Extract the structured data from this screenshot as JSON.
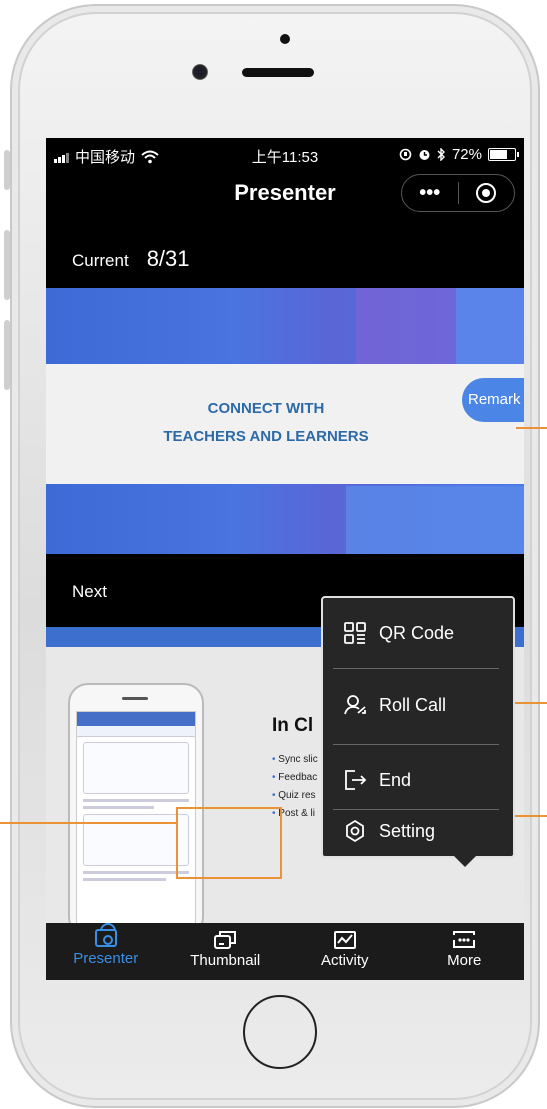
{
  "status_bar": {
    "carrier": "中国移动",
    "time": "上午11:53",
    "battery": "72%",
    "battery_level": 0.72
  },
  "nav": {
    "title": "Presenter",
    "more_glyph": "•••"
  },
  "current": {
    "label": "Current",
    "page": "8/31"
  },
  "current_slide": {
    "line1": "CONNECT WITH",
    "line2": "TEACHERS AND LEARNERS",
    "remark_label": "Remark"
  },
  "next": {
    "label": "Next"
  },
  "next_slide": {
    "heading": "In Cl",
    "bullets": [
      "Sync slic",
      "Feedbac",
      "Quiz res",
      "Post & li"
    ]
  },
  "popup_menu": {
    "items": [
      {
        "label": "QR Code",
        "icon": "qr-code-icon"
      },
      {
        "label": "Roll Call",
        "icon": "roll-call-icon"
      },
      {
        "label": "End",
        "icon": "exit-icon"
      },
      {
        "label": "Setting",
        "icon": "gear-icon"
      }
    ]
  },
  "tabs": [
    {
      "label": "Presenter",
      "icon": "presenter-icon",
      "active": true
    },
    {
      "label": "Thumbnail",
      "icon": "thumbnail-icon",
      "active": false
    },
    {
      "label": "Activity",
      "icon": "activity-icon",
      "active": false
    },
    {
      "label": "More",
      "icon": "more-icon",
      "active": false
    }
  ],
  "colors": {
    "accent": "#3a8ee6",
    "callout": "#e99236",
    "slide_blue": "#4a74e0",
    "banner_text": "#2c6aa8"
  }
}
